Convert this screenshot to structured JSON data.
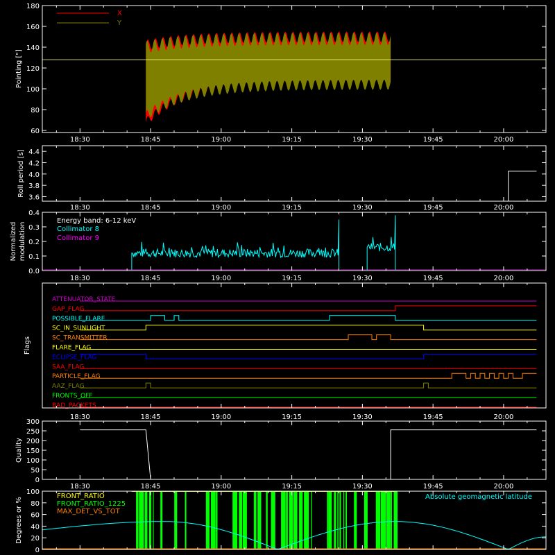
{
  "time_ticks": [
    "18:30",
    "18:45",
    "19:00",
    "19:15",
    "19:30",
    "19:45",
    "20:00"
  ],
  "panels": {
    "pointing": {
      "ylabel": "Pointing [\"]",
      "yticks": [
        60,
        80,
        100,
        120,
        140,
        160,
        180
      ],
      "legend": [
        {
          "label": "X",
          "color": "#ff0000"
        },
        {
          "label": "Y",
          "color": "#808000"
        }
      ],
      "reference_line": 128
    },
    "roll": {
      "ylabel": "Roll period [s]",
      "yticks": [
        "3.6",
        "3.8",
        "4.0",
        "4.2",
        "4.4"
      ]
    },
    "modulation": {
      "ylabel_lines": [
        "Normalized",
        "modulation"
      ],
      "yticks": [
        "0.0",
        "0.1",
        "0.2",
        "0.3",
        "0.4"
      ],
      "legend_title": "Energy band: 6-12 keV",
      "legend": [
        {
          "label": "Collimator 8",
          "color": "#00ffff"
        },
        {
          "label": "Collimator 9",
          "color": "#ff00ff"
        }
      ]
    },
    "flags": {
      "ylabel": "Flags",
      "items": [
        {
          "label": "ATTENUATOR_STATE",
          "color": "#cc00cc"
        },
        {
          "label": "GAP_FLAG",
          "color": "#ff0000"
        },
        {
          "label": "POSSIBLE_FLARE",
          "color": "#00ffff"
        },
        {
          "label": "SC_IN_SUNLIGHT",
          "color": "#ffff00"
        },
        {
          "label": "SC_TRANSMITTER",
          "color": "#ff8000"
        },
        {
          "label": "FLARE_FLAG",
          "color": "#ffff00"
        },
        {
          "label": "ECLIPSE_FLAG",
          "color": "#0000ff"
        },
        {
          "label": "SAA_FLAG",
          "color": "#ff0000"
        },
        {
          "label": "PARTICLE_FLAG",
          "color": "#ff8000"
        },
        {
          "label": "AAZ_FLAG",
          "color": "#808000"
        },
        {
          "label": "FRONTS_OFF",
          "color": "#00ff00"
        },
        {
          "label": "BAD_PACKETS",
          "color": "#ff0000"
        }
      ]
    },
    "quality": {
      "ylabel": "Quality",
      "yticks": [
        0,
        50,
        100,
        150,
        200,
        250,
        300
      ]
    },
    "geo": {
      "ylabel": "Degrees or %",
      "yticks": [
        0,
        20,
        40,
        60,
        80,
        100
      ],
      "legend": [
        {
          "label": "FRONT_RATIO",
          "color": "#ffff00"
        },
        {
          "label": "FRONT_RATIO_1225",
          "color": "#00ff00"
        },
        {
          "label": "MAX_DET_VS_TOT",
          "color": "#ff8000"
        }
      ],
      "right_legend": {
        "label": "Absolute geomagnetic latitude",
        "color": "#00ffff"
      }
    }
  },
  "chart_data": [
    {
      "type": "area",
      "series": [
        {
          "name": "X",
          "x_range": [
            "18:44",
            "19:36"
          ],
          "envelope_min_range": [
            63,
            140
          ],
          "envelope_max_range": [
            145,
            160
          ]
        },
        {
          "name": "Y",
          "x_range": [
            "18:44",
            "19:36"
          ],
          "envelope_min_range": [
            70,
            105
          ],
          "envelope_max_range": [
            140,
            165
          ]
        }
      ],
      "reference_line": 128,
      "ylim": [
        58,
        180
      ]
    },
    {
      "type": "line",
      "points": [
        [
          "20:01",
          3.52
        ],
        [
          "20:01",
          4.05
        ],
        [
          "20:07",
          4.05
        ]
      ],
      "ylim": [
        3.52,
        4.5
      ]
    },
    {
      "type": "line",
      "series": [
        {
          "name": "Collimator 8",
          "segments": [
            {
              "x": [
                "18:41",
                "19:25"
              ],
              "mean": 0.12,
              "spike": [
                "19:25",
                0.35
              ]
            },
            {
              "x": [
                "19:31",
                "19:37"
              ],
              "mean": 0.16,
              "spike": [
                "19:37",
                0.38
              ]
            }
          ]
        },
        {
          "name": "Collimator 9",
          "value": 0.0
        }
      ],
      "ylim": [
        0,
        0.4
      ]
    },
    {
      "type": "line",
      "points": [
        [
          "18:30",
          255
        ],
        [
          "18:44",
          255
        ],
        [
          "18:45",
          0
        ],
        [
          "19:36",
          0
        ],
        [
          "19:36",
          255
        ],
        [
          "20:07",
          255
        ]
      ],
      "ylim": [
        0,
        300
      ]
    },
    {
      "type": "line",
      "series": [
        {
          "name": "Absolute geomagnetic latitude",
          "max": 48,
          "min": 0,
          "peaks": [
            "18:48",
            "19:37"
          ],
          "troughs": [
            "19:12",
            "20:01"
          ]
        }
      ],
      "ylim": [
        0,
        100
      ]
    }
  ]
}
